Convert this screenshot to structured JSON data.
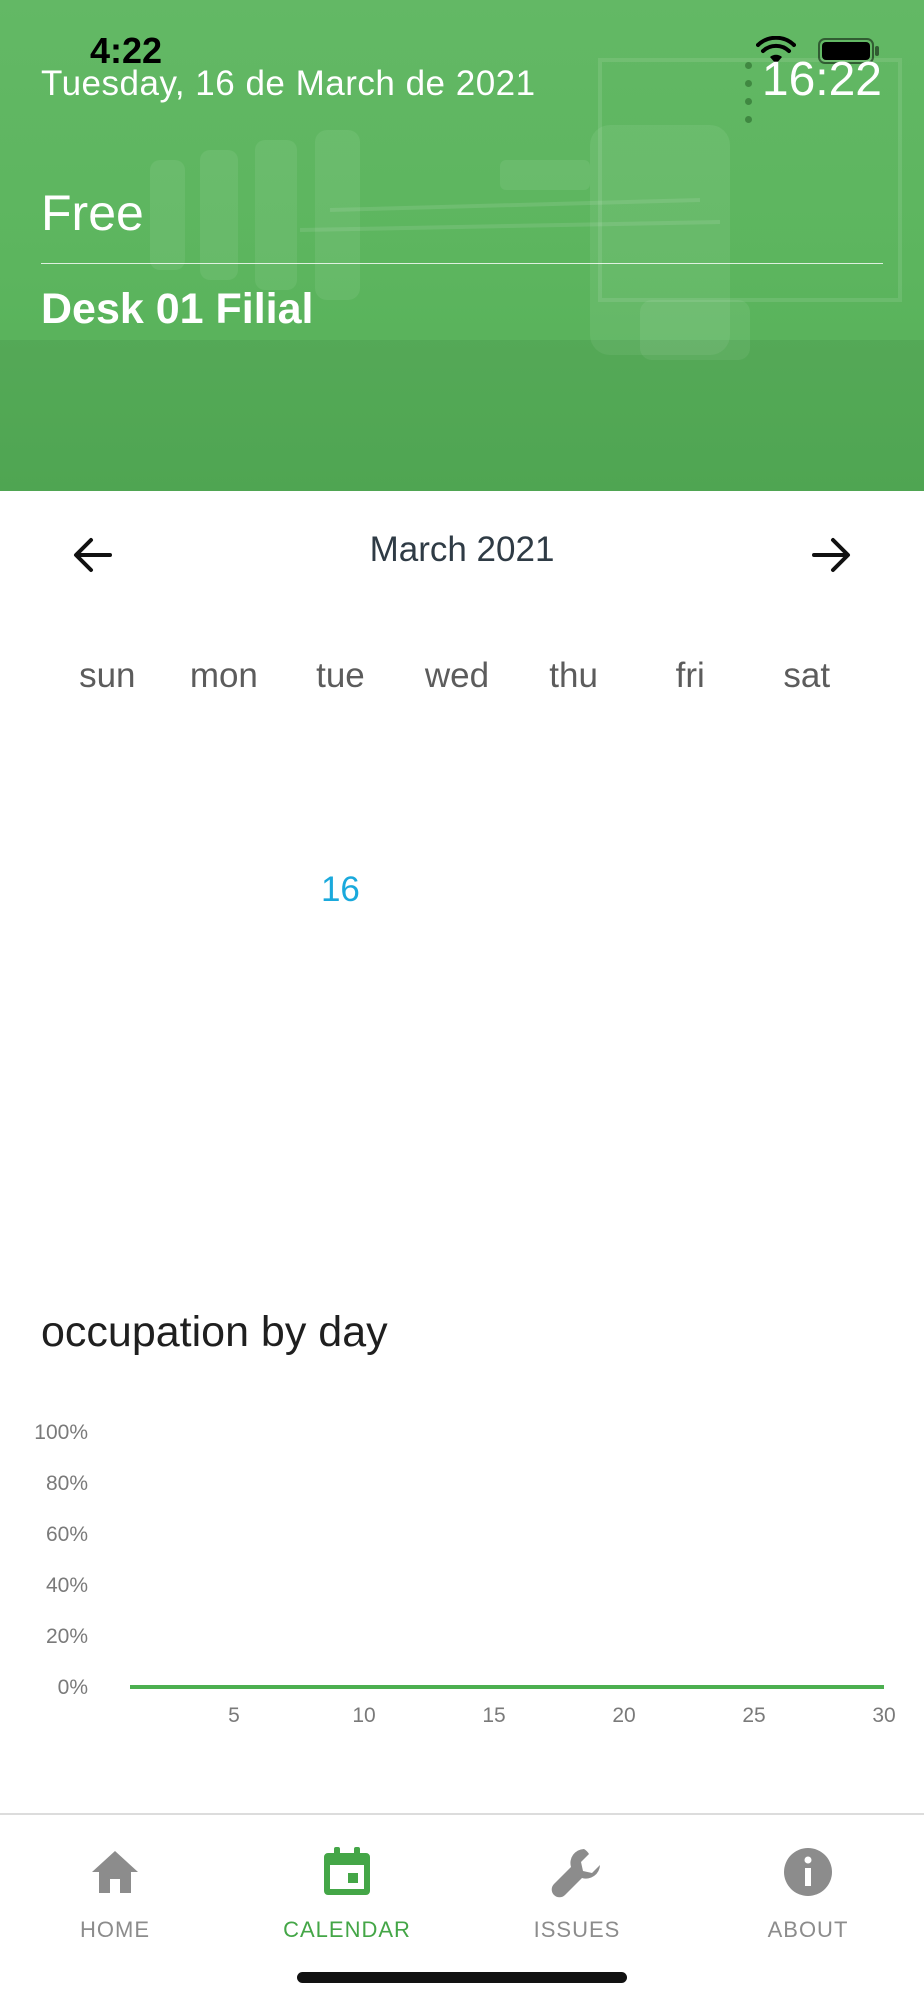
{
  "status_bar": {
    "time": "4:22",
    "icons": [
      "signal-icon",
      "wifi-icon",
      "battery-icon"
    ]
  },
  "header": {
    "date": "Tuesday, 16 de March de 2021",
    "clock": "16:22",
    "status": "Free",
    "room": "Desk 01 Filial",
    "background_color": "#5cb55e"
  },
  "calendar": {
    "month_title": "March 2021",
    "prev_icon": "arrow-left-icon",
    "next_icon": "arrow-right-icon",
    "weekdays": [
      "sun",
      "mon",
      "tue",
      "wed",
      "thu",
      "fri",
      "sat"
    ],
    "visible_days": [
      {
        "day": "",
        "weekday": "sun"
      },
      {
        "day": "",
        "weekday": "mon"
      },
      {
        "day": "16",
        "weekday": "tue",
        "today": true
      },
      {
        "day": "",
        "weekday": "wed"
      },
      {
        "day": "",
        "weekday": "thu"
      },
      {
        "day": "",
        "weekday": "fri"
      },
      {
        "day": "",
        "weekday": "sat"
      }
    ],
    "today_color": "#1aa9dc"
  },
  "chart": {
    "title": "occupation by day"
  },
  "chart_data": {
    "type": "line",
    "title": "occupation by day",
    "xlabel": "",
    "ylabel": "",
    "x": [
      1,
      2,
      3,
      4,
      5,
      6,
      7,
      8,
      9,
      10,
      11,
      12,
      13,
      14,
      15,
      16,
      17,
      18,
      19,
      20,
      21,
      22,
      23,
      24,
      25,
      26,
      27,
      28,
      29,
      30
    ],
    "series": [
      {
        "values": [
          0,
          0,
          0,
          0,
          0,
          0,
          0,
          0,
          0,
          0,
          0,
          0,
          0,
          0,
          0,
          0,
          0,
          0,
          0,
          0,
          0,
          0,
          0,
          0,
          0,
          0,
          0,
          0,
          0,
          0
        ],
        "color": "#4caf50"
      }
    ],
    "xticks": [
      5,
      10,
      15,
      20,
      25,
      30
    ],
    "xtick_labels": [
      "5",
      "10",
      "15",
      "20",
      "25",
      "30"
    ],
    "yticks": [
      0,
      20,
      40,
      60,
      80,
      100
    ],
    "ytick_labels": [
      "0%",
      "20%",
      "40%",
      "60%",
      "80%",
      "100%"
    ],
    "xlim": [
      1,
      30
    ],
    "ylim": [
      0,
      100
    ],
    "grid": false,
    "legend": "none"
  },
  "bottom_nav": {
    "items": [
      {
        "label": "HOME",
        "icon": "home-icon",
        "active": false
      },
      {
        "label": "CALENDAR",
        "icon": "calendar-icon",
        "active": true
      },
      {
        "label": "ISSUES",
        "icon": "wrench-icon",
        "active": false
      },
      {
        "label": "ABOUT",
        "icon": "info-icon",
        "active": false
      }
    ],
    "active_color": "#44a647",
    "inactive_color": "#8c8c8c"
  }
}
